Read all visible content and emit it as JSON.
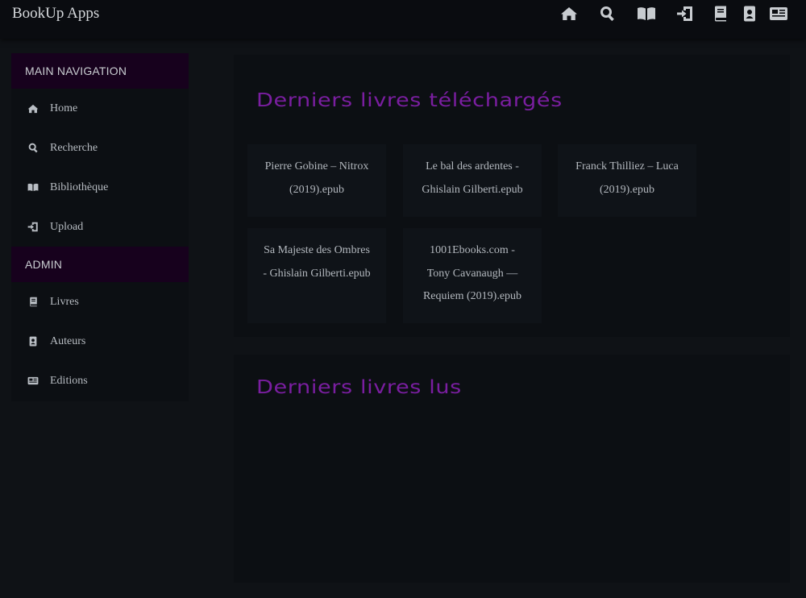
{
  "app": {
    "title": "BookUp Apps"
  },
  "topnav": {
    "icons": [
      "home-icon",
      "search-icon",
      "book-open-icon",
      "upload-icon",
      "book-icon",
      "id-badge-icon",
      "newspaper-icon"
    ]
  },
  "sidebar": {
    "main_header": "MAIN NAVIGATION",
    "main_items": [
      {
        "label": "Home",
        "icon": "home-icon"
      },
      {
        "label": "Recherche",
        "icon": "search-icon"
      },
      {
        "label": "Bibliothèque",
        "icon": "book-open-icon"
      },
      {
        "label": "Upload",
        "icon": "upload-icon"
      }
    ],
    "admin_header": "ADMIN",
    "admin_items": [
      {
        "label": "Livres",
        "icon": "book-icon"
      },
      {
        "label": "Auteurs",
        "icon": "id-badge-icon"
      },
      {
        "label": "Editions",
        "icon": "newspaper-icon"
      }
    ]
  },
  "main": {
    "downloaded": {
      "title": "Derniers livres téléchargés",
      "books": [
        {
          "line1": "Pierre Gobine – Nitrox",
          "line2": "(2019).epub"
        },
        {
          "line1": "Le bal des ardentes -",
          "line2": "Ghislain Gilberti.epub"
        },
        {
          "line1": "Franck Thilliez – Luca",
          "line2": "(2019).epub"
        },
        {
          "line1": "Sa Majeste des Ombres",
          "line2": "- Ghislain Gilberti.epub"
        },
        {
          "line1": "1001Ebooks.com -",
          "line2": "Tony Cavanaugh —",
          "line3": "Requiem (2019).epub"
        }
      ]
    },
    "read": {
      "title": "Derniers livres lus"
    }
  },
  "colors": {
    "accent": "#7a1ea0",
    "sidebar_header": "#17011d",
    "background": "#0f1216",
    "panel": "#0c0f13"
  }
}
